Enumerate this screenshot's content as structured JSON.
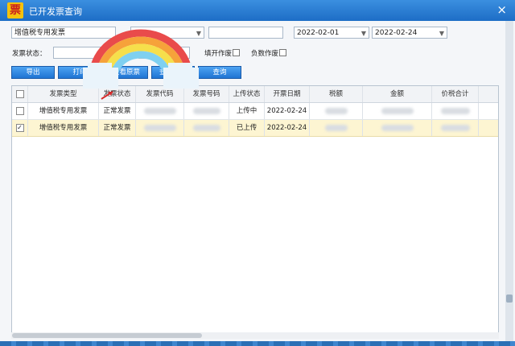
{
  "window": {
    "title": "已开发票查询",
    "app_icon_glyph": "票",
    "close_glyph": "×"
  },
  "filters": {
    "invoice_type": "增值税专用发票",
    "start_date": "2022-02-01",
    "end_date": "2022-02-24",
    "status_label": "发票状态：",
    "cancel_label": "填开作废",
    "negative_label": "负数作废"
  },
  "toolbar": {
    "export_label": "导出",
    "print_label": "打印",
    "view_original_label": "查看原票",
    "query_settings_label": "查询设置",
    "query_label": "查询"
  },
  "table": {
    "columns": [
      "发票类型",
      "发票状态",
      "发票代码",
      "发票号码",
      "上传状态",
      "开票日期",
      "税额",
      "金额",
      "价税合计"
    ],
    "rows": [
      {
        "checked": "",
        "type": "增值税专用发票",
        "status": "正常发票",
        "upload": "上传中",
        "date": "2022-02-24"
      },
      {
        "checked": "✓",
        "type": "增值税专用发票",
        "status": "正常发票",
        "upload": "已上传",
        "date": "2022-02-24"
      }
    ]
  }
}
